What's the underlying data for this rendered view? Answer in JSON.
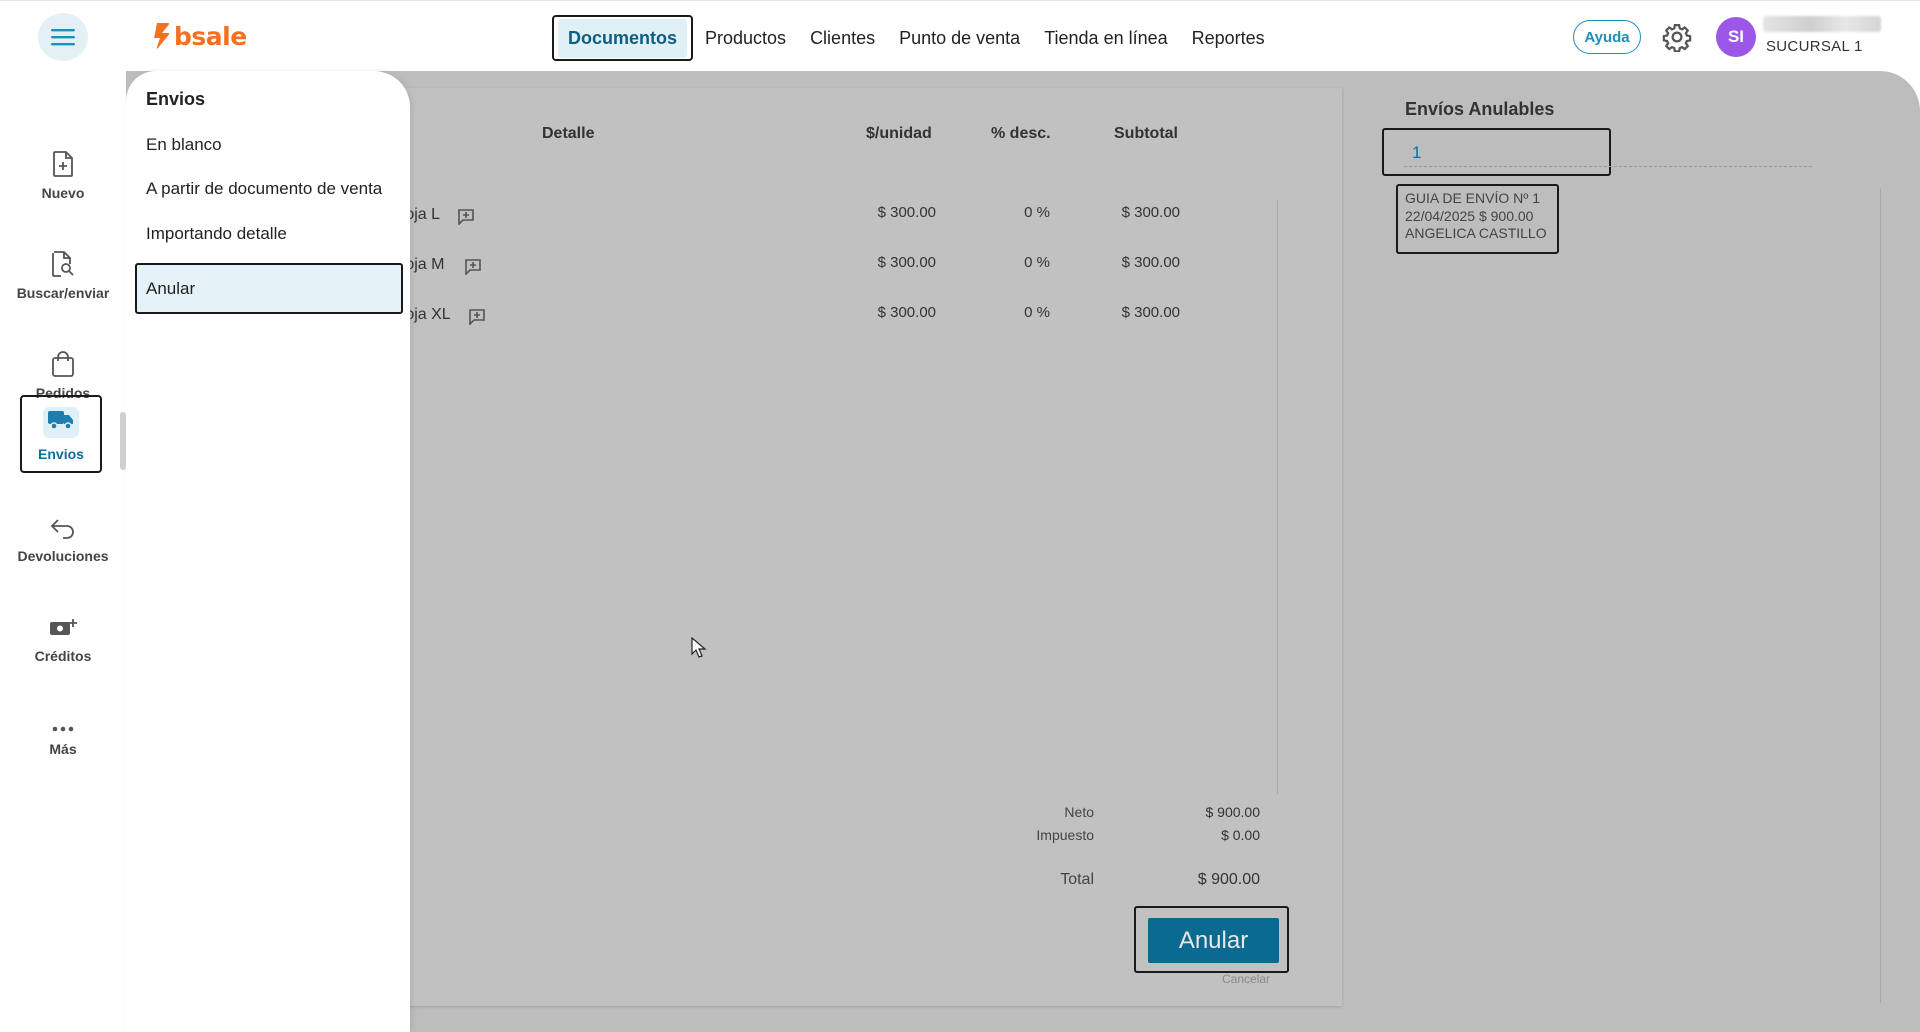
{
  "brand": {
    "name": "bsale",
    "color": "#f5701f",
    "accent": "#0e6f9c"
  },
  "nav": {
    "items": [
      {
        "label": "Documentos",
        "active": true
      },
      {
        "label": "Productos"
      },
      {
        "label": "Clientes"
      },
      {
        "label": "Punto de venta"
      },
      {
        "label": "Tienda en línea"
      },
      {
        "label": "Reportes"
      }
    ],
    "help_label": "Ayuda",
    "avatar_initials": "SI",
    "branch": "SUCURSAL 1"
  },
  "rail": {
    "items": [
      {
        "label": "Nuevo",
        "icon": "new-document-icon"
      },
      {
        "label": "Buscar/enviar",
        "icon": "search-document-icon"
      },
      {
        "label": "Pedidos",
        "icon": "shopping-bag-icon"
      },
      {
        "label": "Envios",
        "icon": "truck-icon",
        "active": true
      },
      {
        "label": "Devoluciones",
        "icon": "return-arrow-icon"
      },
      {
        "label": "Créditos",
        "icon": "money-plus-icon"
      },
      {
        "label": "Más",
        "icon": "more-dots-icon"
      }
    ]
  },
  "flyout": {
    "title": "Envios",
    "items": [
      {
        "label": "En blanco"
      },
      {
        "label": "A partir de documento de venta"
      },
      {
        "label": "Importando detalle"
      },
      {
        "label": "Anular",
        "active": true
      }
    ]
  },
  "document": {
    "columns": {
      "detail": "Detalle",
      "unit_price": "$/unidad",
      "discount": "% desc.",
      "subtotal": "Subtotal"
    },
    "rows": [
      {
        "detail": "roja L",
        "unit_price": "$ 300.00",
        "discount": "0 %",
        "subtotal": "$ 300.00"
      },
      {
        "detail": "roja M",
        "unit_price": "$ 300.00",
        "discount": "0 %",
        "subtotal": "$ 300.00"
      },
      {
        "detail": "roja XL",
        "unit_price": "$ 300.00",
        "discount": "0 %",
        "subtotal": "$ 300.00"
      }
    ],
    "totals": {
      "neto_label": "Neto",
      "neto": "$ 900.00",
      "impuesto_label": "Impuesto",
      "impuesto": "$ 0.00",
      "total_label": "Total",
      "total": "$ 900.00"
    },
    "submit_label": "Anular",
    "cancel_label": "Cancelar"
  },
  "annullable": {
    "title": "Envíos Anulables",
    "search_value": "1",
    "result": {
      "line1": "GUIA DE ENVÍO Nº 1",
      "line2": "22/04/2025 $ 900.00",
      "line3": "ANGELICA CASTILLO"
    }
  }
}
